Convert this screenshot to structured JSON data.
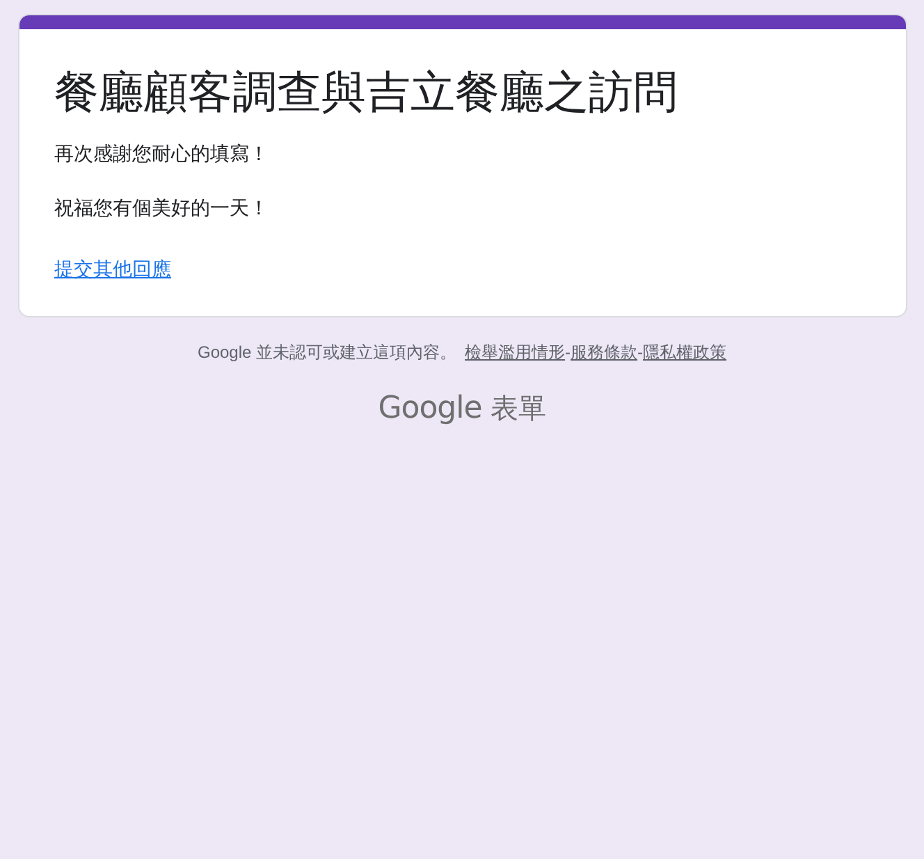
{
  "form": {
    "title": "餐廳顧客調查與吉立餐廳之訪問",
    "messages": [
      "再次感謝您耐心的填寫！",
      "祝福您有個美好的一天！"
    ],
    "link": "提交其他回應"
  },
  "footer": {
    "notice": "Google 並未認可或建立這項內容。",
    "links": [
      "檢舉濫用情形",
      "服務條款",
      "隱私權政策"
    ],
    "separator": "-"
  },
  "logo": {
    "brand": "Google",
    "product": "表單"
  }
}
